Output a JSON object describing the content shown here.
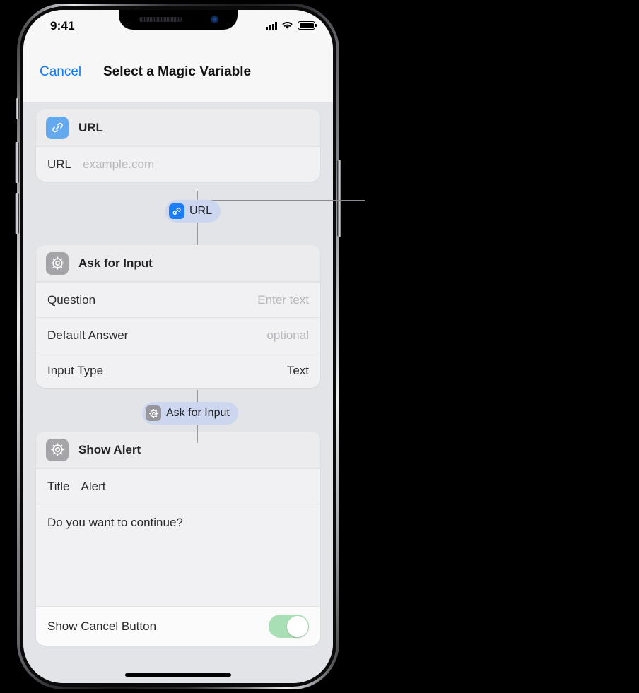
{
  "status_bar": {
    "time": "9:41",
    "signal_icon": "cellular-signal-icon",
    "wifi_icon": "wifi-icon",
    "battery_icon": "battery-full-icon"
  },
  "nav_bar": {
    "cancel_label": "Cancel",
    "title": "Select a Magic Variable"
  },
  "actions": [
    {
      "id": "url",
      "icon": "link-icon",
      "icon_color": "#64a8f0",
      "title": "URL",
      "rows": [
        {
          "label": "URL",
          "value": "example.com",
          "is_placeholder": true
        }
      ],
      "output_pill": {
        "icon": "link-icon",
        "label": "URL",
        "selected": true
      }
    },
    {
      "id": "ask-for-input",
      "icon": "gear-icon",
      "icon_color": "#a4a4a9",
      "title": "Ask for Input",
      "rows": [
        {
          "label": "Question",
          "value": "Enter text",
          "is_placeholder": true
        },
        {
          "label": "Default Answer",
          "value": "optional",
          "is_placeholder": true
        },
        {
          "label": "Input Type",
          "value": "Text",
          "is_placeholder": false
        }
      ],
      "output_pill": {
        "icon": "gear-icon",
        "label": "Ask for Input",
        "selected": false
      }
    },
    {
      "id": "show-alert",
      "icon": "gear-icon",
      "icon_color": "#a4a4a9",
      "title": "Show Alert",
      "title_row": {
        "label": "Title",
        "value": "Alert"
      },
      "message": "Do you want to continue?",
      "toggle_row": {
        "label": "Show Cancel Button",
        "value": "on"
      }
    }
  ],
  "colors": {
    "accent_blue": "#0a7cff",
    "pill_background": "#ccd7ef",
    "pill_icon_blue": "#1b7ef7",
    "toggle_on_green": "#a9dfb4",
    "screen_background": "#e3e4e8",
    "card_background": "#f1f1f3"
  },
  "home_indicator": "home-indicator"
}
